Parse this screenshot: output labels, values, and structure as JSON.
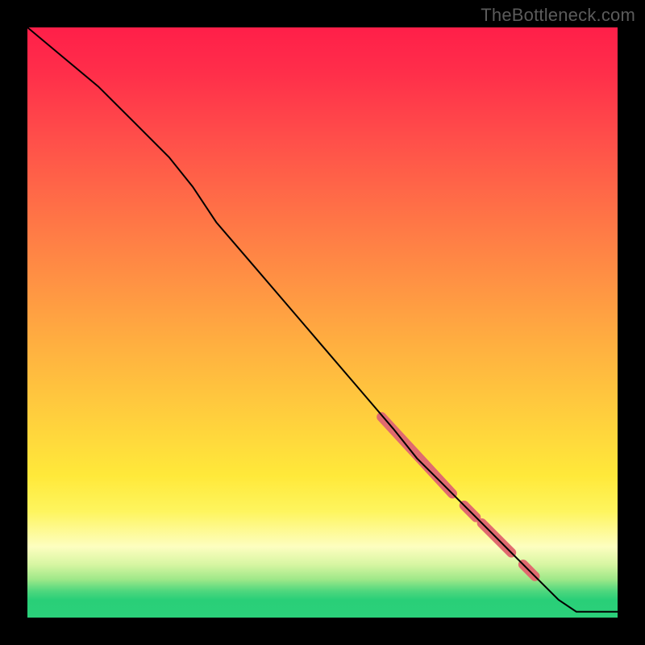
{
  "attribution": "TheBottleneck.com",
  "gradient_colors": {
    "top": "#ff1f49",
    "mid_orange": "#ff8f44",
    "yellow": "#ffe93a",
    "pale": "#fdfec0",
    "green": "#2bd07a"
  },
  "chart_data": {
    "type": "line",
    "title": "",
    "xlabel": "",
    "ylabel": "",
    "xlim": [
      0,
      100
    ],
    "ylim": [
      0,
      100
    ],
    "grid": false,
    "legend": false,
    "note": "Axes have no tick labels in the source; x and y are normalized 0–100. Curve estimated from pixels.",
    "series": [
      {
        "name": "main-curve",
        "color": "#000000",
        "stroke_width": 2,
        "x": [
          0,
          6,
          12,
          18,
          24,
          28,
          32,
          38,
          44,
          50,
          56,
          62,
          66,
          70,
          74,
          78,
          82,
          86,
          90,
          93,
          96,
          98,
          100
        ],
        "y": [
          100,
          95,
          90,
          84,
          78,
          73,
          67,
          60,
          53,
          46,
          39,
          32,
          27,
          23,
          19,
          15,
          11,
          7,
          3,
          1,
          1,
          1,
          1
        ]
      }
    ],
    "highlighted_segments": [
      {
        "name": "segment-1",
        "color": "#e06a6f",
        "stroke_width": 12,
        "x_range": [
          60,
          72
        ],
        "y_range": [
          34,
          21
        ]
      },
      {
        "name": "dot-1",
        "color": "#e06a6f",
        "stroke_width": 12,
        "x_range": [
          74,
          76
        ],
        "y_range": [
          19,
          17
        ]
      },
      {
        "name": "segment-2",
        "color": "#e06a6f",
        "stroke_width": 12,
        "x_range": [
          77,
          82
        ],
        "y_range": [
          16,
          11
        ]
      },
      {
        "name": "dot-2",
        "color": "#e06a6f",
        "stroke_width": 12,
        "x_range": [
          84,
          86
        ],
        "y_range": [
          9,
          7
        ]
      }
    ]
  }
}
